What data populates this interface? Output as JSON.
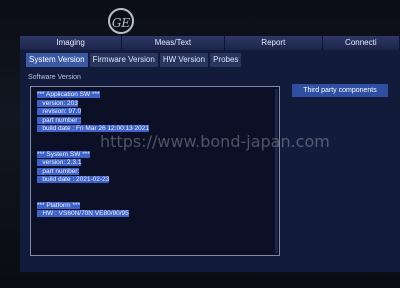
{
  "logo": {
    "text": "GE"
  },
  "top_nav": [
    {
      "label": "Imaging"
    },
    {
      "label": "Meas/Text"
    },
    {
      "label": "Report"
    },
    {
      "label": "Connecti"
    }
  ],
  "sub_tabs": [
    {
      "label": "System Version",
      "active": true
    },
    {
      "label": "Firmware Version",
      "active": false
    },
    {
      "label": "HW Version",
      "active": false
    },
    {
      "label": "Probes",
      "active": false
    }
  ],
  "section_label": "Software Version",
  "version_lines": [
    "*** Application SW ***",
    "   version: 203",
    "   revision: 97.0",
    "   part number :",
    "   build date : Fri Mar 26 12:00:13 2021",
    "",
    "",
    "*** System SW ***",
    "   version: 2.3.1",
    "   part number:",
    "   build date : 2021-02-23",
    "",
    "",
    "*** Platform ***",
    "   HW : VS60N/70N VE80/90/95"
  ],
  "third_party_button": "Third party components",
  "watermark": "https://www.bond-japan.com",
  "colors": {
    "highlight": "#3f62c8",
    "active_tab": "#3b5aa6",
    "button": "#2f4fa2"
  }
}
